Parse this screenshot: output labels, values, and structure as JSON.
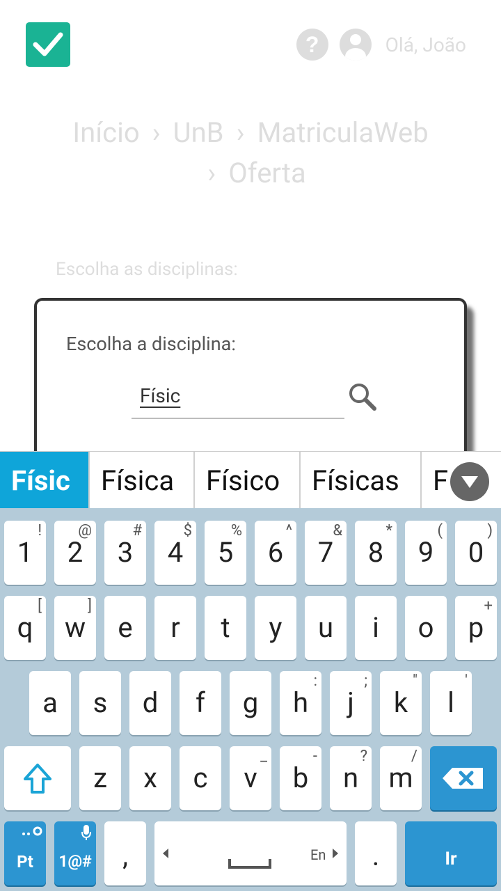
{
  "header": {
    "greeting": "Olá, João",
    "help_glyph": "?",
    "brand_color": "#1ab394"
  },
  "breadcrumb": {
    "items": [
      "Início",
      "UnB",
      "MatriculaWeb",
      "Oferta"
    ],
    "separator": "›"
  },
  "page": {
    "choose_label": "Escolha as disciplinas:"
  },
  "dialog": {
    "title": "Escolha a disciplina:",
    "search_value": "Físic"
  },
  "keyboard": {
    "suggestions": [
      "Físic",
      "Física",
      "Físico",
      "Físicas",
      "F"
    ],
    "accent": "#0fa5d9",
    "rows": [
      [
        {
          "label": "1",
          "hint": "!"
        },
        {
          "label": "2",
          "hint": "@"
        },
        {
          "label": "3",
          "hint": "#"
        },
        {
          "label": "4",
          "hint": "$"
        },
        {
          "label": "5",
          "hint": "%"
        },
        {
          "label": "6",
          "hint": "^"
        },
        {
          "label": "7",
          "hint": "&"
        },
        {
          "label": "8",
          "hint": "*"
        },
        {
          "label": "9",
          "hint": "("
        },
        {
          "label": "0",
          "hint": ")"
        }
      ],
      [
        {
          "label": "q",
          "hint": "["
        },
        {
          "label": "w",
          "hint": "]"
        },
        {
          "label": "e",
          "hint": ""
        },
        {
          "label": "r",
          "hint": ""
        },
        {
          "label": "t",
          "hint": ""
        },
        {
          "label": "y",
          "hint": ""
        },
        {
          "label": "u",
          "hint": ""
        },
        {
          "label": "i",
          "hint": ""
        },
        {
          "label": "o",
          "hint": ""
        },
        {
          "label": "p",
          "hint": "+"
        }
      ],
      [
        {
          "label": "a",
          "hint": ""
        },
        {
          "label": "s",
          "hint": ""
        },
        {
          "label": "d",
          "hint": ""
        },
        {
          "label": "f",
          "hint": ""
        },
        {
          "label": "g",
          "hint": ""
        },
        {
          "label": "h",
          "hint": ":"
        },
        {
          "label": "j",
          "hint": ";"
        },
        {
          "label": "k",
          "hint": "\""
        },
        {
          "label": "l",
          "hint": "'"
        }
      ],
      [
        {
          "label": "z",
          "hint": ""
        },
        {
          "label": "x",
          "hint": ""
        },
        {
          "label": "c",
          "hint": ""
        },
        {
          "label": "v",
          "hint": "_"
        },
        {
          "label": "b",
          "hint": "-"
        },
        {
          "label": "n",
          "hint": "?"
        },
        {
          "label": "m",
          "hint": "/"
        }
      ]
    ],
    "lang_key": "Pt",
    "symbols_key": "1@#",
    "comma_key": ",",
    "space_lang": "En",
    "period_key": ".",
    "go_key": "Ir"
  }
}
